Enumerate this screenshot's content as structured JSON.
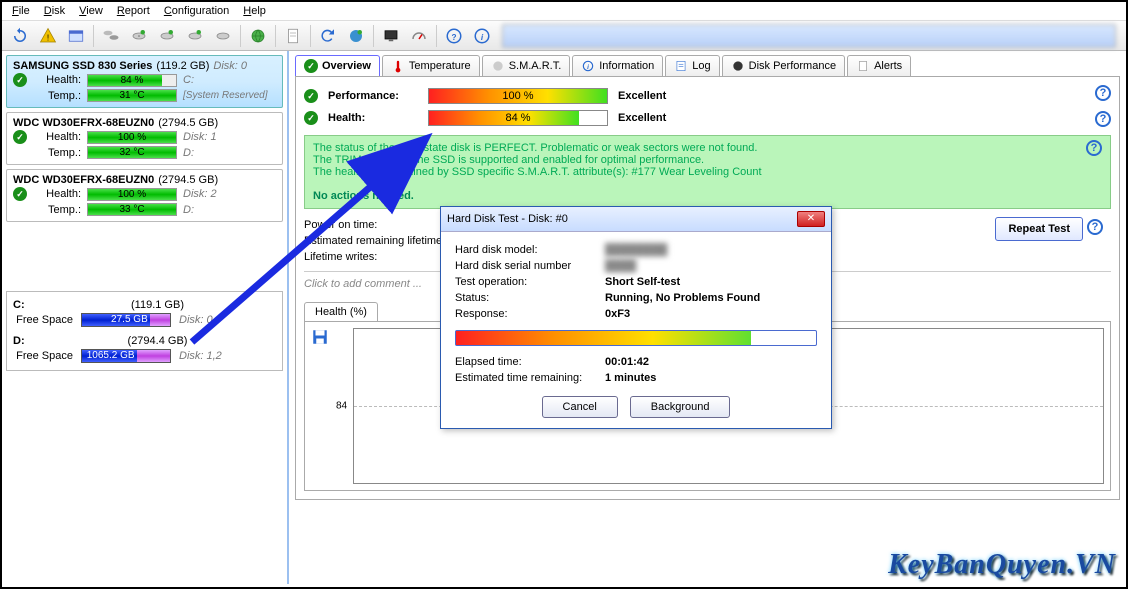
{
  "menu": [
    "File",
    "Disk",
    "View",
    "Report",
    "Configuration",
    "Help"
  ],
  "toolbar_icons": [
    "refresh",
    "warning",
    "browser",
    "globe-group",
    "disk-sm1",
    "disk-sm2",
    "disk-sm3",
    "disk-sm4",
    "globe",
    "doc",
    "refresh2",
    "globe2",
    "monitor",
    "gauge",
    "help",
    "info"
  ],
  "disks": [
    {
      "name": "SAMSUNG SSD 830 Series",
      "cap": "(119.2 GB)",
      "num": "Disk: 0",
      "health": "84 %",
      "health_pct": 84,
      "temp": "31 °C",
      "drive": "C:",
      "extra": "[System Reserved]",
      "sel": true
    },
    {
      "name": "WDC WD30EFRX-68EUZN0",
      "cap": "(2794.5 GB)",
      "num": "",
      "health": "100 %",
      "health_pct": 100,
      "temp": "32 °C",
      "drive": "D:",
      "disknum": "Disk: 1"
    },
    {
      "name": "WDC WD30EFRX-68EUZN0",
      "cap": "(2794.5 GB)",
      "num": "",
      "health": "100 %",
      "health_pct": 100,
      "temp": "33 °C",
      "drive": "D:",
      "disknum": "Disk: 2"
    }
  ],
  "volumes": [
    {
      "letter": "C:",
      "cap": "(119.1 GB)",
      "free_label": "Free Space",
      "free": "27.5 GB",
      "free_pct": 23,
      "disk": "Disk: 0"
    },
    {
      "letter": "D:",
      "cap": "(2794.4 GB)",
      "free_label": "Free Space",
      "free": "1065.2 GB",
      "free_pct": 38,
      "disk": "Disk: 1,2"
    }
  ],
  "tabs": [
    "Overview",
    "Temperature",
    "S.M.A.R.T.",
    "Information",
    "Log",
    "Disk Performance",
    "Alerts"
  ],
  "tab_icons": [
    "check",
    "temp",
    "smart",
    "info",
    "log",
    "perf",
    "alert"
  ],
  "metrics": {
    "perf_label": "Performance:",
    "perf_val": "100 %",
    "perf_pct": 100,
    "perf_rating": "Excellent",
    "health_label": "Health:",
    "health_val": "84 %",
    "health_pct": 84,
    "health_rating": "Excellent"
  },
  "status": {
    "line1": "The status of the solid state disk is PERFECT. Problematic or weak sectors were not found.",
    "line2": "The TRIM feature of the SSD is supported and enabled for optimal performance.",
    "line3": "The health is determined by SSD specific S.M.A.R.T. attribute(s):  #177 Wear Leveling Count",
    "action": "No actions needed."
  },
  "info": {
    "pot": "Power on time:",
    "erl": "Estimated remaining lifetime",
    "lw": "Lifetime writes:"
  },
  "repeat": "Repeat Test",
  "comment": "Click to add comment ...",
  "chart": {
    "tab": "Health (%)",
    "axis": "84",
    "val": "84"
  },
  "dialog": {
    "title": "Hard Disk Test - Disk: #0",
    "rows": [
      {
        "k": "Hard disk model:",
        "v": ""
      },
      {
        "k": "Hard disk serial number",
        "v": ""
      },
      {
        "k": "Test operation:",
        "v": "Short Self-test"
      },
      {
        "k": "Status:",
        "v": "Running, No Problems Found"
      },
      {
        "k": "Response:",
        "v": "0xF3"
      }
    ],
    "elapsed_k": "Elapsed time:",
    "elapsed_v": "00:01:42",
    "eta_k": "Estimated time remaining:",
    "eta_v": "1 minutes",
    "prog_pct": 82,
    "btn_cancel": "Cancel",
    "btn_bg": "Background"
  },
  "watermark": "KeyBanQuyen.VN"
}
